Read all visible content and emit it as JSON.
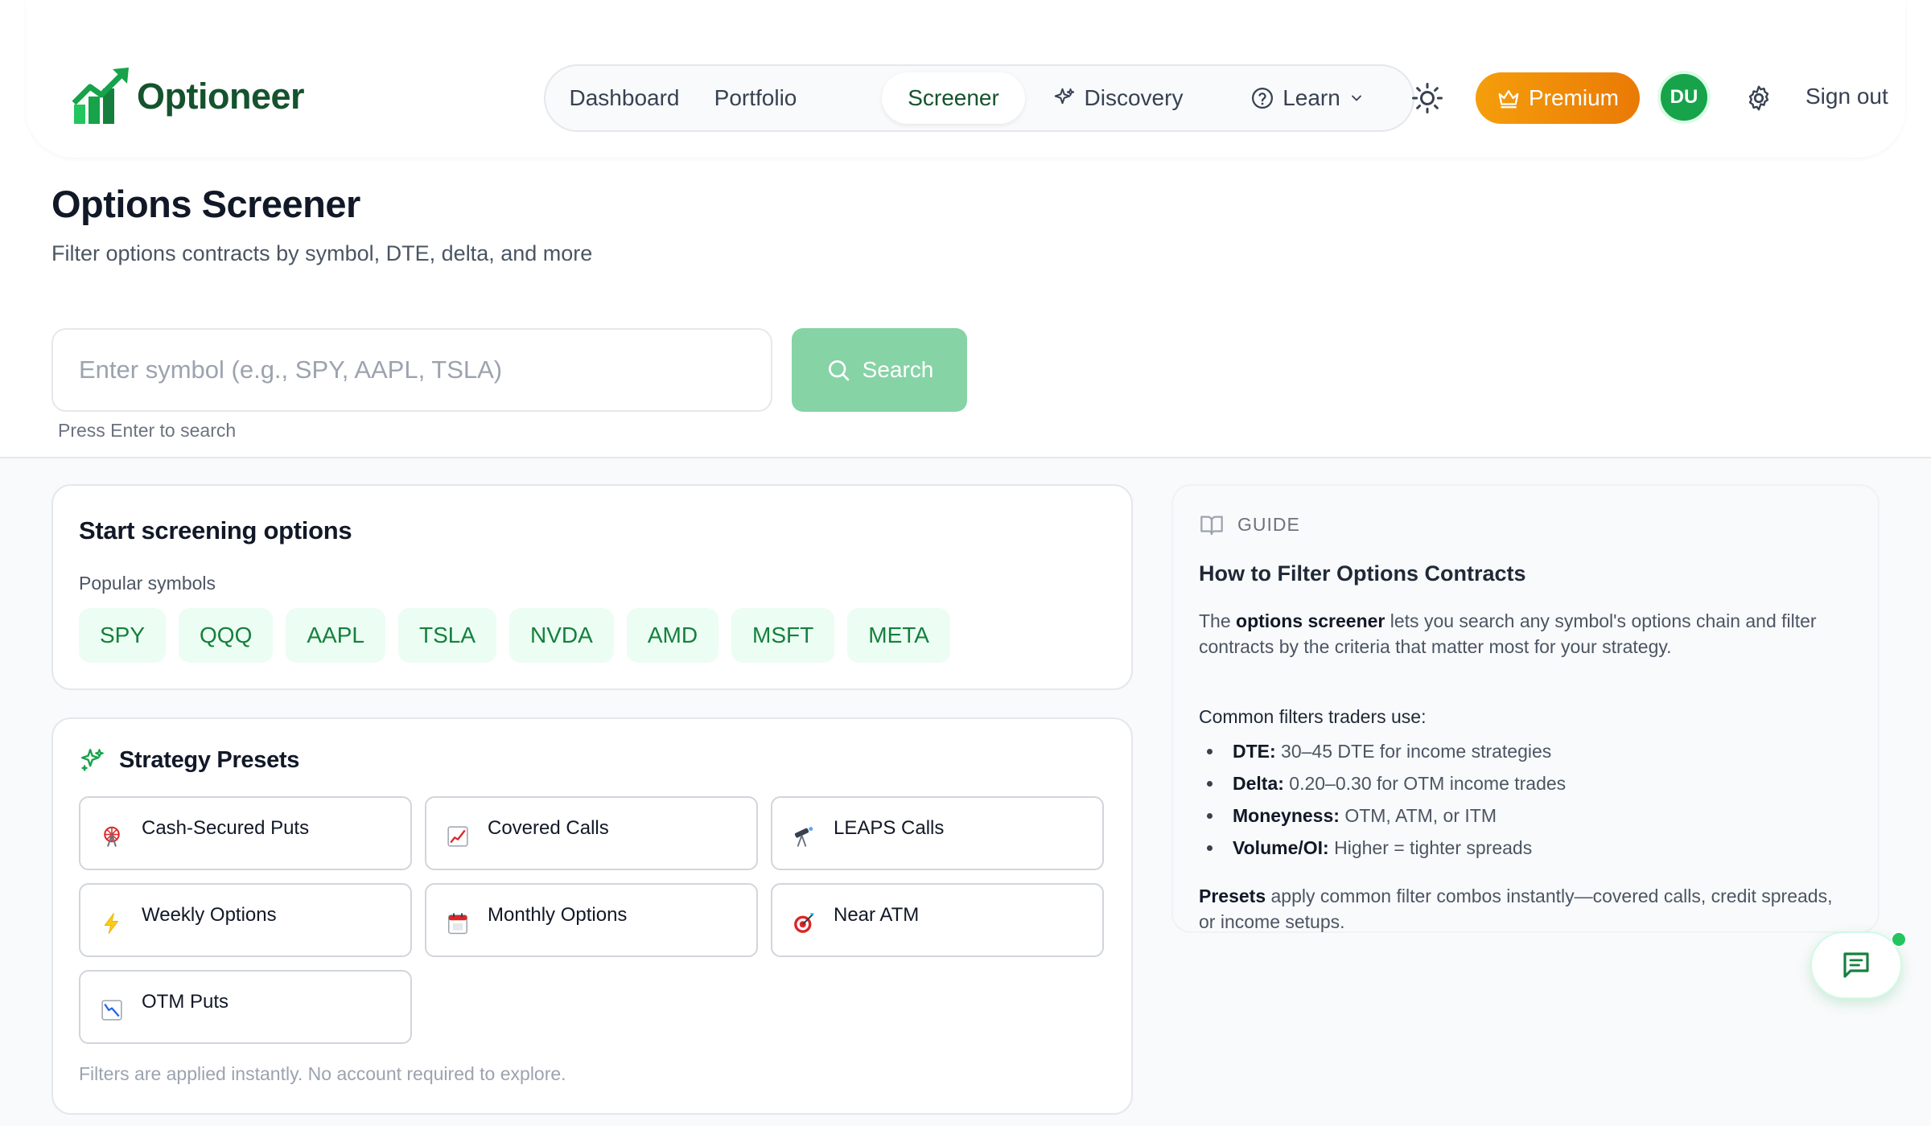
{
  "app": {
    "name": "Optioneer",
    "brand_color": "#16a34a",
    "accent_color": "#f59e0b"
  },
  "nav": {
    "items": [
      {
        "label": "Dashboard",
        "active": false
      },
      {
        "label": "Portfolio",
        "active": false
      },
      {
        "label": "Screener",
        "active": true
      },
      {
        "label": "Discovery",
        "active": false,
        "icon": "sparkles-icon"
      },
      {
        "label": "Learn",
        "active": false,
        "icon": "help-circle-icon"
      }
    ],
    "premium_label": "Premium",
    "avatar_initials": "DU",
    "signout_label": "Sign out"
  },
  "page": {
    "title": "Options Screener",
    "subtitle": "Filter options contracts by symbol, DTE, delta, and more"
  },
  "search": {
    "placeholder": "Enter symbol (e.g., SPY, AAPL, TSLA)",
    "value": "",
    "button_label": "Search",
    "hint": "Press Enter to search"
  },
  "start": {
    "title": "Start screening options",
    "popular_label": "Popular symbols",
    "symbols": [
      "SPY",
      "QQQ",
      "AAPL",
      "TSLA",
      "NVDA",
      "AMD",
      "MSFT",
      "META"
    ]
  },
  "presets": {
    "title": "Strategy Presets",
    "items": [
      {
        "label": "Cash-Secured Puts",
        "icon": "ferris-wheel-icon"
      },
      {
        "label": "Covered Calls",
        "icon": "chart-up-icon"
      },
      {
        "label": "LEAPS Calls",
        "icon": "telescope-icon"
      },
      {
        "label": "Weekly Options",
        "icon": "lightning-icon"
      },
      {
        "label": "Monthly Options",
        "icon": "calendar-icon"
      },
      {
        "label": "Near ATM",
        "icon": "target-icon"
      },
      {
        "label": "OTM Puts",
        "icon": "chart-down-icon"
      }
    ],
    "footnote": "Filters are applied instantly. No account required to explore."
  },
  "guide": {
    "label": "GUIDE",
    "title": "How to Filter Options Contracts",
    "intro_pre": "The ",
    "intro_bold": "options screener",
    "intro_post": " lets you search any symbol's options chain and filter contracts by the criteria that matter most for your strategy.",
    "common_label": "Common filters traders use:",
    "filters": [
      {
        "term": "DTE:",
        "text": " 30–45 DTE for income strategies"
      },
      {
        "term": "Delta:",
        "text": " 0.20–0.30 for OTM income trades"
      },
      {
        "term": "Moneyness:",
        "text": " OTM, ATM, or ITM"
      },
      {
        "term": "Volume/OI:",
        "text": " Higher = tighter spreads"
      }
    ],
    "outro_bold": "Presets",
    "outro_post": " apply common filter combos instantly—covered calls, credit spreads, or income setups."
  }
}
